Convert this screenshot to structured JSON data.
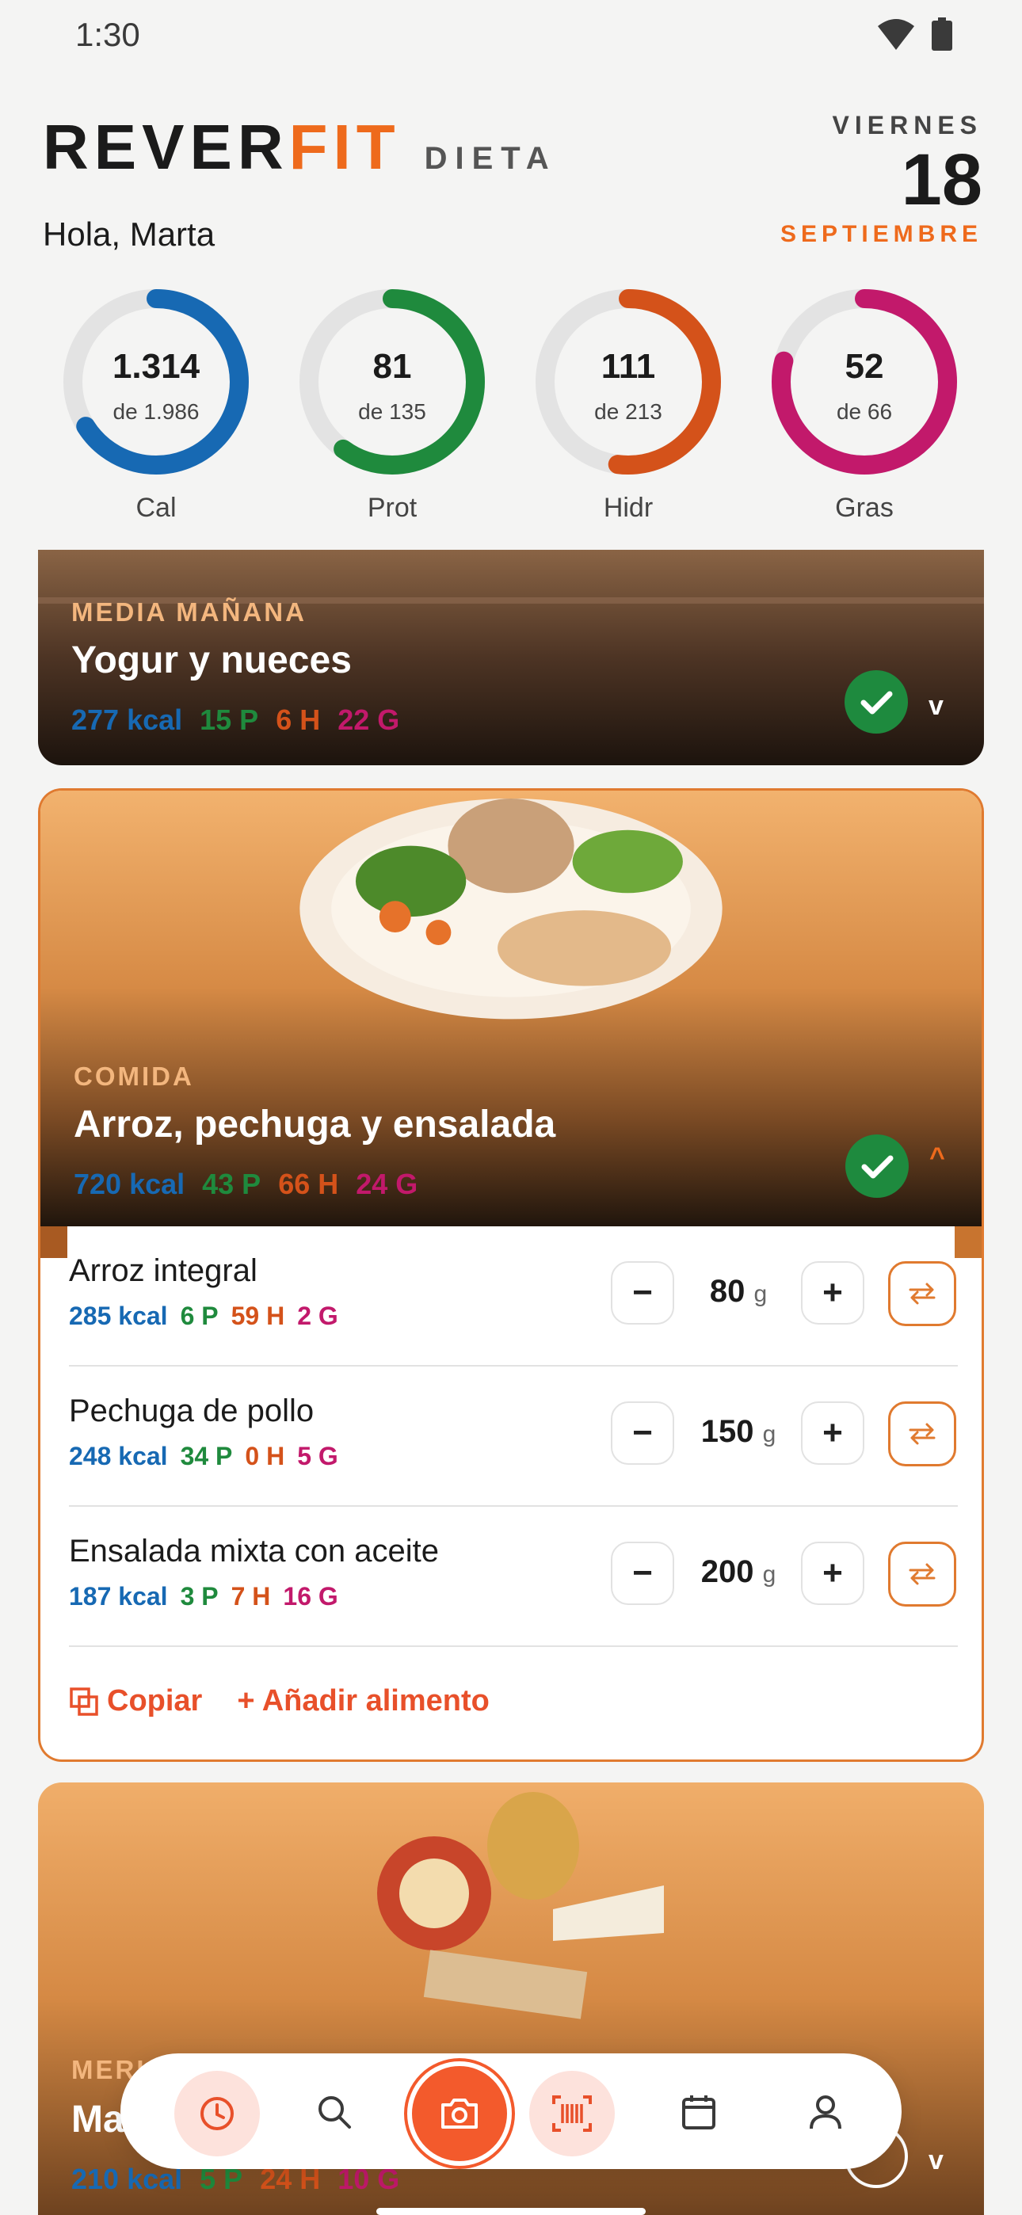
{
  "status": {
    "time": "1:30"
  },
  "header": {
    "brand_part1": "REVER",
    "brand_part2": "FIT",
    "brand_part3": "DIETA",
    "greeting": "Hola, Marta",
    "weekday": "VIERNES",
    "day": "18",
    "month": "SEPTIEMBRE"
  },
  "summary": [
    {
      "value": "1.314",
      "target": "de 1.986",
      "label": "Cal",
      "progress": 0.66,
      "color": "#1769b3"
    },
    {
      "value": "81",
      "target": "de 135",
      "label": "Prot",
      "progress": 0.6,
      "color": "#1f8a3d"
    },
    {
      "value": "111",
      "target": "de 213",
      "label": "Hidr",
      "progress": 0.52,
      "color": "#d4521a"
    },
    {
      "value": "52",
      "target": "de 66",
      "label": "Gras",
      "progress": 0.79,
      "color": "#c2196b"
    }
  ],
  "meals": [
    {
      "kicker": "MEDIA MAÑANA",
      "title": "Yogur y nueces",
      "kcal": "277 kcal",
      "p": "15 P",
      "h": "6 H",
      "g": "22 G",
      "done": true,
      "expanded": false
    },
    {
      "kicker": "COMIDA",
      "title": "Arroz, pechuga y ensalada",
      "kcal": "720 kcal",
      "p": "43 P",
      "h": "66 H",
      "g": "24 G",
      "done": true,
      "expanded": true
    },
    {
      "kicker": "MERI",
      "title": "Ma",
      "kcal": "210 kcal",
      "p": "5 P",
      "h": "24 H",
      "g": "10 G",
      "done": false,
      "expanded": false
    }
  ],
  "foods": [
    {
      "name": "Arroz integral",
      "kcal": "285 kcal",
      "p": "6 P",
      "h": "59 H",
      "g": "2 G",
      "qty": "80",
      "unit": "g"
    },
    {
      "name": "Pechuga de pollo",
      "kcal": "248 kcal",
      "p": "34 P",
      "h": "0 H",
      "g": "5 G",
      "qty": "150",
      "unit": "g"
    },
    {
      "name": "Ensalada mixta con aceite",
      "kcal": "187 kcal",
      "p": "3 P",
      "h": "7 H",
      "g": "16 G",
      "qty": "200",
      "unit": "g"
    }
  ],
  "stepper": {
    "minus": "−",
    "plus": "+"
  },
  "actions": {
    "copy": "Copiar",
    "add": "+ Añadir alimento"
  },
  "chevrons": {
    "down": "v",
    "up": "^"
  },
  "nav": [
    "clock-icon",
    "search-icon",
    "camera-icon",
    "barcode-icon",
    "calendar-icon",
    "profile-icon"
  ],
  "colors": {
    "accent": "#ee6a1c",
    "kcal": "#1769b3",
    "prot": "#1f8a3d",
    "hidr": "#d4521a",
    "gras": "#c2196b",
    "check": "#1e8a3e"
  }
}
